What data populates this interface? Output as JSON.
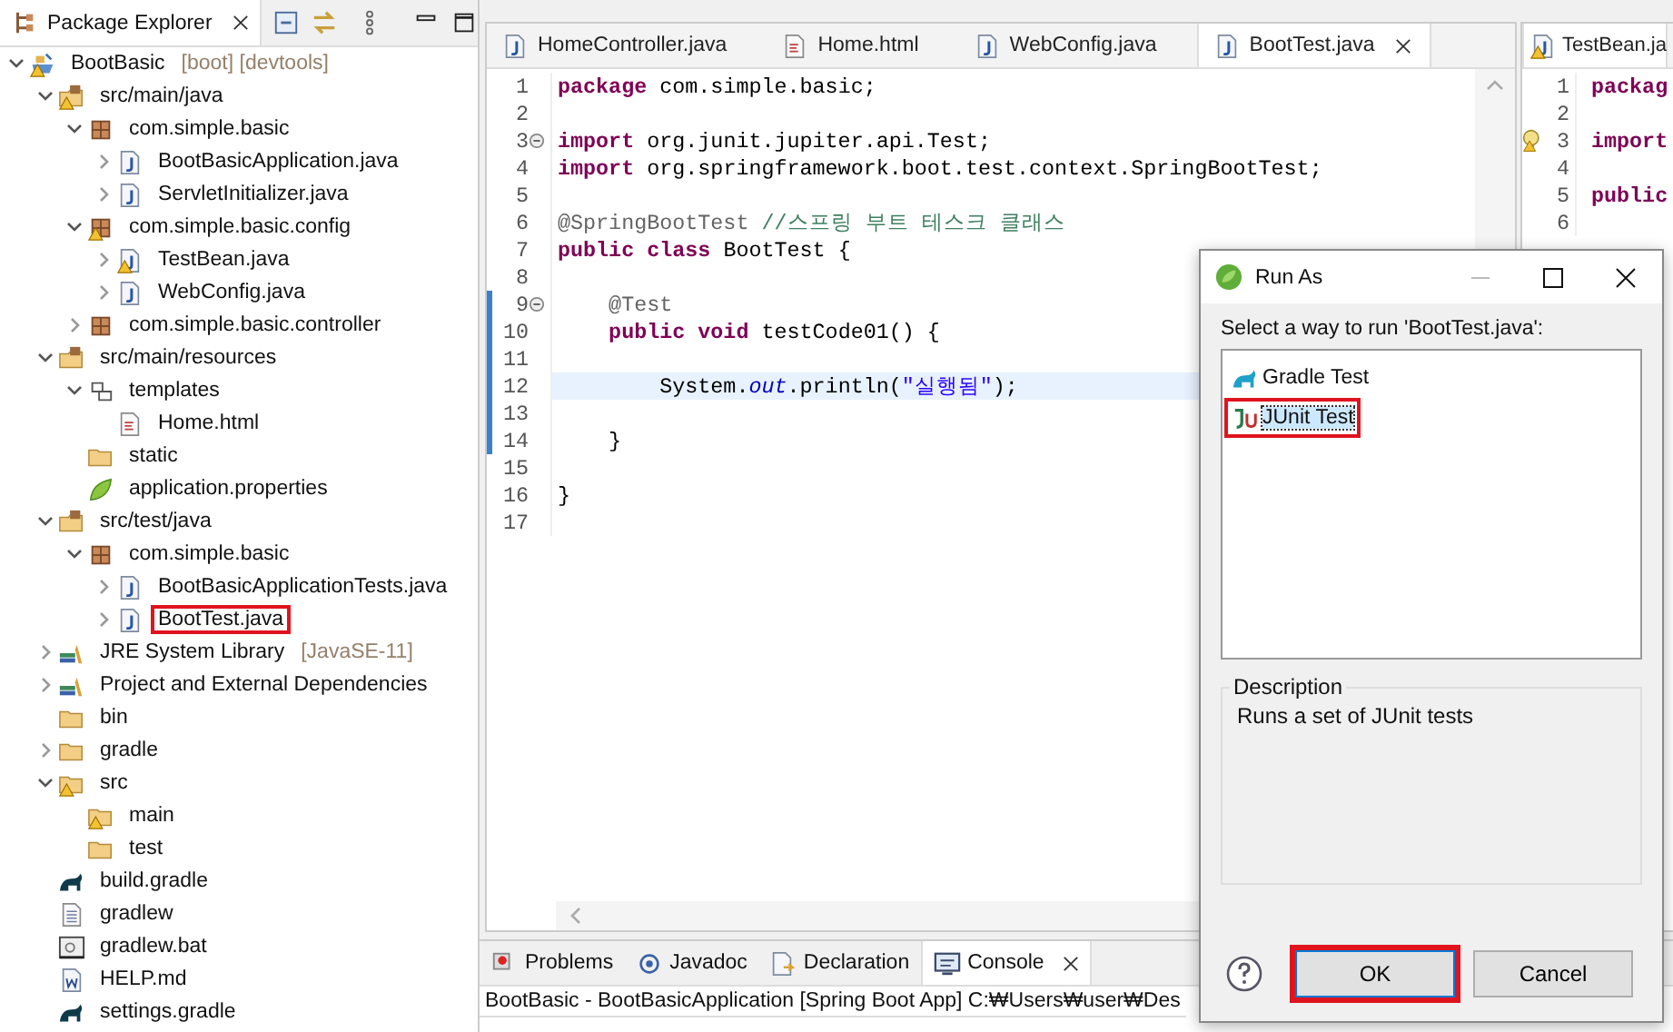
{
  "explorer": {
    "title": "Package Explorer",
    "tree": [
      {
        "label": "BootBasic",
        "decoration": "[boot] [devtools]",
        "kind": "project",
        "expanded": true,
        "warning": true,
        "highlighted": false,
        "children": [
          {
            "label": "src/main/java",
            "kind": "source-folder",
            "expanded": true,
            "warning": true,
            "highlighted": false,
            "children": [
              {
                "label": "com.simple.basic",
                "kind": "package",
                "expanded": true,
                "warning": false,
                "highlighted": false,
                "children": [
                  {
                    "label": "BootBasicApplication.java",
                    "kind": "java",
                    "expanded": false,
                    "warning": false,
                    "highlighted": false
                  },
                  {
                    "label": "ServletInitializer.java",
                    "kind": "java",
                    "expanded": false,
                    "warning": false,
                    "highlighted": false
                  }
                ]
              },
              {
                "label": "com.simple.basic.config",
                "kind": "package",
                "expanded": true,
                "warning": true,
                "highlighted": false,
                "children": [
                  {
                    "label": "TestBean.java",
                    "kind": "java",
                    "expanded": false,
                    "warning": true,
                    "highlighted": false
                  },
                  {
                    "label": "WebConfig.java",
                    "kind": "java",
                    "expanded": false,
                    "warning": false,
                    "highlighted": false
                  }
                ]
              },
              {
                "label": "com.simple.basic.controller",
                "kind": "package",
                "expanded": false,
                "warning": false,
                "highlighted": false
              }
            ]
          },
          {
            "label": "src/main/resources",
            "kind": "source-folder",
            "expanded": true,
            "warning": false,
            "highlighted": false,
            "children": [
              {
                "label": "templates",
                "kind": "folder-package",
                "expanded": true,
                "warning": false,
                "highlighted": false,
                "children": [
                  {
                    "label": "Home.html",
                    "kind": "html",
                    "warning": false,
                    "highlighted": false
                  }
                ]
              },
              {
                "label": "static",
                "kind": "folder",
                "warning": false,
                "highlighted": false
              },
              {
                "label": "application.properties",
                "kind": "properties",
                "warning": false,
                "highlighted": false
              }
            ]
          },
          {
            "label": "src/test/java",
            "kind": "source-folder",
            "expanded": true,
            "warning": false,
            "highlighted": false,
            "children": [
              {
                "label": "com.simple.basic",
                "kind": "package",
                "expanded": true,
                "warning": false,
                "highlighted": false,
                "children": [
                  {
                    "label": "BootBasicApplicationTests.java",
                    "kind": "java",
                    "expanded": false,
                    "warning": false,
                    "highlighted": false
                  },
                  {
                    "label": "BootTest.java",
                    "kind": "java",
                    "expanded": false,
                    "warning": false,
                    "highlighted": true
                  }
                ]
              }
            ]
          },
          {
            "label": "JRE System Library",
            "decoration": "[JavaSE-11]",
            "kind": "library",
            "expanded": false,
            "warning": false,
            "highlighted": false
          },
          {
            "label": "Project and External Dependencies",
            "kind": "library",
            "expanded": false,
            "warning": false,
            "highlighted": false
          },
          {
            "label": "bin",
            "kind": "folder",
            "warning": false,
            "highlighted": false
          },
          {
            "label": "gradle",
            "kind": "folder",
            "expanded": false,
            "warning": false,
            "highlighted": false
          },
          {
            "label": "src",
            "kind": "folder",
            "expanded": true,
            "warning": true,
            "highlighted": false,
            "children": [
              {
                "label": "main",
                "kind": "folder",
                "warning": true,
                "highlighted": false
              },
              {
                "label": "test",
                "kind": "folder",
                "warning": false,
                "highlighted": false
              }
            ]
          },
          {
            "label": "build.gradle",
            "kind": "gradle",
            "warning": false,
            "highlighted": false
          },
          {
            "label": "gradlew",
            "kind": "text",
            "warning": false,
            "highlighted": false
          },
          {
            "label": "gradlew.bat",
            "kind": "bat",
            "warning": false,
            "highlighted": false
          },
          {
            "label": "HELP.md",
            "kind": "doc",
            "warning": false,
            "highlighted": false
          },
          {
            "label": "settings.gradle",
            "kind": "gradle",
            "warning": false,
            "highlighted": false
          }
        ]
      }
    ]
  },
  "editor": {
    "tabs": [
      {
        "label": "HomeController.java",
        "kind": "java",
        "selected": false
      },
      {
        "label": "Home.html",
        "kind": "html",
        "selected": false
      },
      {
        "label": "WebConfig.java",
        "kind": "java",
        "selected": false
      },
      {
        "label": "BootTest.java",
        "kind": "java",
        "selected": true
      }
    ],
    "lines": [
      {
        "number": "1",
        "fold": false,
        "current": false,
        "changed": false,
        "tokens": [
          {
            "text": "package",
            "kind": "keyword"
          },
          {
            "text": " com.simple.basic;",
            "kind": "plain"
          }
        ]
      },
      {
        "number": "2",
        "fold": false,
        "current": false,
        "changed": false
      },
      {
        "number": "3",
        "fold": true,
        "current": false,
        "changed": false,
        "tokens": [
          {
            "text": "import",
            "kind": "keyword"
          },
          {
            "text": " org.junit.jupiter.api.Test;",
            "kind": "plain"
          }
        ]
      },
      {
        "number": "4",
        "fold": false,
        "current": false,
        "changed": false,
        "tokens": [
          {
            "text": "import",
            "kind": "keyword"
          },
          {
            "text": " org.springframework.boot.test.context.SpringBootTest;",
            "kind": "plain"
          }
        ]
      },
      {
        "number": "5",
        "fold": false,
        "current": false,
        "changed": false
      },
      {
        "number": "6",
        "fold": false,
        "current": false,
        "changed": false,
        "tokens": [
          {
            "text": "@SpringBootTest",
            "kind": "annotation"
          },
          {
            "text": " //스프링 부트 테스크 클래스",
            "kind": "comment"
          }
        ]
      },
      {
        "number": "7",
        "fold": false,
        "current": false,
        "changed": false,
        "tokens": [
          {
            "text": "public",
            "kind": "keyword"
          },
          {
            "text": " class",
            "kind": "keyword"
          },
          {
            "text": " BootTest {",
            "kind": "plain"
          }
        ]
      },
      {
        "number": "8",
        "fold": false,
        "current": false,
        "changed": false
      },
      {
        "number": "9",
        "fold": true,
        "current": false,
        "changed": true,
        "tokens": [
          {
            "text": "    @Test",
            "kind": "annotation"
          }
        ]
      },
      {
        "number": "10",
        "fold": false,
        "current": false,
        "changed": true,
        "tokens": [
          {
            "text": "    public",
            "kind": "keyword"
          },
          {
            "text": " void",
            "kind": "keyword"
          },
          {
            "text": " testCode01() {",
            "kind": "plain"
          }
        ]
      },
      {
        "number": "11",
        "fold": false,
        "current": false,
        "changed": true
      },
      {
        "number": "12",
        "fold": false,
        "current": true,
        "changed": true,
        "tokens": [
          {
            "text": "        System.",
            "kind": "plain"
          },
          {
            "text": "out",
            "kind": "field"
          },
          {
            "text": ".println(",
            "kind": "plain"
          },
          {
            "text": "\"실행됨\"",
            "kind": "string"
          },
          {
            "text": ");",
            "kind": "plain"
          }
        ]
      },
      {
        "number": "13",
        "fold": false,
        "current": false,
        "changed": true
      },
      {
        "number": "14",
        "fold": false,
        "current": false,
        "changed": true,
        "tokens": [
          {
            "text": "    }",
            "kind": "plain"
          }
        ]
      },
      {
        "number": "15",
        "fold": false,
        "current": false,
        "changed": false
      },
      {
        "number": "16",
        "fold": false,
        "current": false,
        "changed": false,
        "tokens": [
          {
            "text": "}",
            "kind": "plain"
          }
        ]
      },
      {
        "number": "17",
        "fold": false,
        "current": false,
        "changed": false
      }
    ]
  },
  "side_editor": {
    "tab": {
      "label": "TestBean.ja",
      "kind": "java",
      "warning": true
    },
    "lines": [
      {
        "number": "1",
        "warning": false,
        "text": "packag"
      },
      {
        "number": "2",
        "warning": false
      },
      {
        "number": "3",
        "warning": true,
        "text": "import"
      },
      {
        "number": "4",
        "warning": false
      },
      {
        "number": "5",
        "warning": false,
        "text": "public"
      },
      {
        "number": "6",
        "warning": false
      }
    ]
  },
  "bottom_panel": {
    "tabs": [
      {
        "label": "Problems",
        "kind": "problems",
        "selected": false
      },
      {
        "label": "Javadoc",
        "kind": "javadoc",
        "selected": false
      },
      {
        "label": "Declaration",
        "kind": "declaration",
        "selected": false
      },
      {
        "label": "Console",
        "kind": "console",
        "selected": true
      }
    ],
    "console_title": "BootBasic - BootBasicApplication [Spring Boot App] C:₩Users₩user₩Des"
  },
  "dialog": {
    "title": "Run As",
    "prompt": "Select a way to run 'BootTest.java':",
    "options": [
      {
        "label": "Gradle Test",
        "kind": "gradle",
        "selected": false,
        "highlighted": false
      },
      {
        "label": "JUnit Test",
        "kind": "junit",
        "selected": true,
        "highlighted": true
      }
    ],
    "description_title": "Description",
    "description": "Runs a set of JUnit tests",
    "buttons": [
      {
        "label": "OK",
        "default": true,
        "highlighted": true
      },
      {
        "label": "Cancel",
        "default": false,
        "highlighted": false
      }
    ]
  }
}
